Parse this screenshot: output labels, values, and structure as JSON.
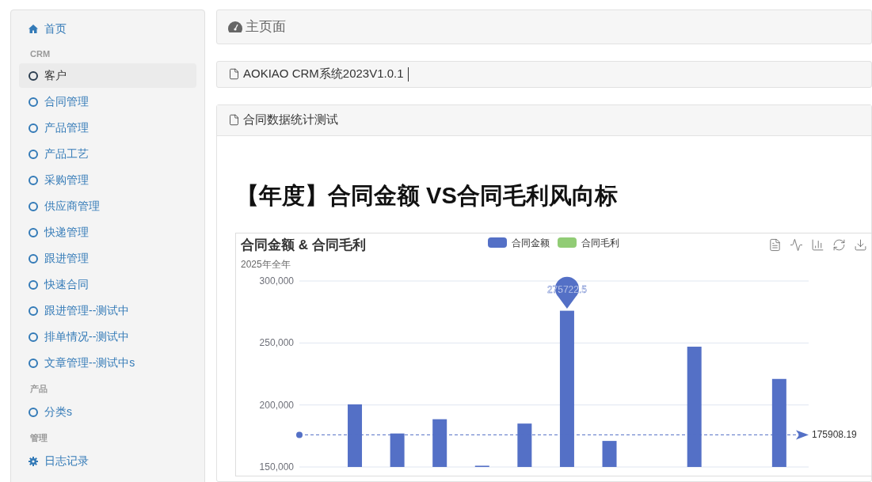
{
  "sidebar": {
    "home": {
      "label": "首页"
    },
    "groups": [
      {
        "title": "CRM",
        "items": [
          {
            "label": "客户",
            "selected": true,
            "kind": "circle"
          },
          {
            "label": "合同管理",
            "selected": false,
            "kind": "circle"
          },
          {
            "label": "产品管理",
            "selected": false,
            "kind": "circle"
          },
          {
            "label": "产品工艺",
            "selected": false,
            "kind": "circle"
          },
          {
            "label": "采购管理",
            "selected": false,
            "kind": "circle"
          },
          {
            "label": "供应商管理",
            "selected": false,
            "kind": "circle"
          },
          {
            "label": "快递管理",
            "selected": false,
            "kind": "circle"
          },
          {
            "label": "跟进管理",
            "selected": false,
            "kind": "circle"
          },
          {
            "label": "快速合同",
            "selected": false,
            "kind": "circle"
          },
          {
            "label": "跟进管理--测试中",
            "selected": false,
            "kind": "circle"
          },
          {
            "label": "排单情况--测试中",
            "selected": false,
            "kind": "circle"
          },
          {
            "label": "文章管理--测试中s",
            "selected": false,
            "kind": "circle"
          }
        ]
      },
      {
        "title": "产品",
        "items": [
          {
            "label": "分类s",
            "selected": false,
            "kind": "circle"
          }
        ]
      },
      {
        "title": "管理",
        "items": [
          {
            "label": "日志记录",
            "selected": false,
            "kind": "gear"
          }
        ]
      }
    ]
  },
  "page_title": "主页面",
  "version_panel": {
    "title": "AOKIAO CRM系统2023V1.0.1"
  },
  "stats_panel": {
    "title": "合同数据统计测试",
    "heading": "【年度】合同金额 VS合同毛利风向标",
    "chart": {
      "subtitle": "2025年全年",
      "chart_data": {
        "type": "bar",
        "title": "合同金额 & 合同毛利",
        "ylim": [
          150000,
          300000
        ],
        "grid": true,
        "yticks": [
          {
            "value": 150000,
            "label": "150,000"
          },
          {
            "value": 200000,
            "label": "200,000"
          },
          {
            "value": 250000,
            "label": "250,000"
          },
          {
            "value": 300000,
            "label": "300,000"
          }
        ],
        "series": [
          {
            "name": "合同金额",
            "color": "#5470c6",
            "values": [
              null,
              200500,
              177000,
              188500,
              151000,
              185000,
              276000,
              171000,
              null,
              247000,
              null,
              221000
            ]
          },
          {
            "name": "合同毛利",
            "color": "#91cc75",
            "values": [
              null,
              null,
              null,
              null,
              null,
              null,
              null,
              null,
              null,
              null,
              null,
              null
            ]
          }
        ],
        "annotations": [
          {
            "text": "275722.5",
            "y": 275722.5
          }
        ],
        "ref_lines": [
          {
            "axis": "y",
            "value": 175908.19,
            "label": "175908.19"
          }
        ]
      }
    }
  }
}
